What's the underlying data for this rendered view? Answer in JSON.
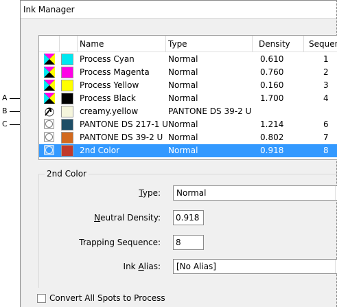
{
  "window": {
    "title": "Ink Manager"
  },
  "callouts": [
    "A",
    "B",
    "C"
  ],
  "columns": {
    "name": "Name",
    "type": "Type",
    "density": "Density",
    "sequence": "Sequence"
  },
  "inks": [
    {
      "name": "Process Cyan",
      "type": "Normal",
      "density": "0.610",
      "sequence": "1",
      "swatch": "#00e8f0",
      "icon": "process",
      "selected": false
    },
    {
      "name": "Process Magenta",
      "type": "Normal",
      "density": "0.760",
      "sequence": "2",
      "swatch": "#ff00e6",
      "icon": "process",
      "selected": false
    },
    {
      "name": "Process Yellow",
      "type": "Normal",
      "density": "0.160",
      "sequence": "3",
      "swatch": "#ffff00",
      "icon": "process",
      "selected": false
    },
    {
      "name": "Process Black",
      "type": "Normal",
      "density": "1.700",
      "sequence": "4",
      "swatch": "#000000",
      "icon": "process",
      "selected": false
    },
    {
      "name": "creamy.yellow",
      "type": "PANTONE DS 39-2 U",
      "density": "",
      "sequence": "",
      "swatch": "#f5f5dc",
      "icon": "alias",
      "selected": false
    },
    {
      "name": "PANTONE DS 217-1 U",
      "type": "Normal",
      "density": "1.214",
      "sequence": "6",
      "swatch": "#1e4e66",
      "icon": "spot",
      "selected": false
    },
    {
      "name": "PANTONE DS 39-2 U",
      "type": "Normal",
      "density": "0.802",
      "sequence": "7",
      "swatch": "#d2691e",
      "icon": "spot",
      "selected": false
    },
    {
      "name": "2nd Color",
      "type": "Normal",
      "density": "0.918",
      "sequence": "8",
      "swatch": "#c0392b",
      "icon": "spot",
      "selected": true
    }
  ],
  "panel": {
    "legend": "2nd Color",
    "type_label_pre": "",
    "type_label_u": "T",
    "type_label_post": "ype:",
    "type_value": "Normal",
    "density_label_u": "N",
    "density_label_post": "eutral Density:",
    "density_value": "0.918",
    "trap_label": "Trapping Sequence:",
    "trap_value": "8",
    "alias_label_pre": "Ink ",
    "alias_label_u": "A",
    "alias_label_post": "lias:",
    "alias_value": "[No Alias]"
  },
  "convert_label": "Convert All Spots to Process",
  "colors": {
    "selection": "#3399ff"
  }
}
